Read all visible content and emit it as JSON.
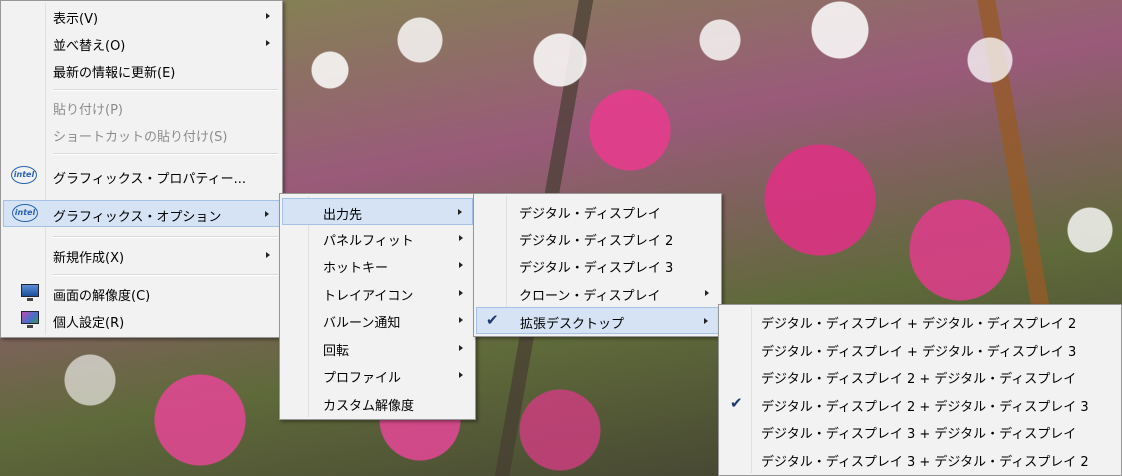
{
  "desktop_menu": {
    "items": [
      {
        "label": "表示(V)",
        "submenu": true
      },
      {
        "label": "並べ替え(O)",
        "submenu": true
      },
      {
        "label": "最新の情報に更新(E)"
      },
      {
        "label": "貼り付け(P)",
        "disabled": true
      },
      {
        "label": "ショートカットの貼り付け(S)",
        "disabled": true
      },
      {
        "label": "グラフィックス・プロパティー...",
        "icon": "intel-logo-icon"
      },
      {
        "label": "グラフィックス・オプション",
        "icon": "intel-logo-icon",
        "submenu": true,
        "highlighted": true
      },
      {
        "label": "新規作成(X)",
        "submenu": true
      },
      {
        "label": "画面の解像度(C)",
        "icon": "display-monitor-icon"
      },
      {
        "label": "個人設定(R)",
        "icon": "personalize-monitor-icon"
      }
    ]
  },
  "graphics_options_menu": {
    "items": [
      {
        "label": "出力先",
        "submenu": true,
        "highlighted": true
      },
      {
        "label": "パネルフィット",
        "submenu": true
      },
      {
        "label": "ホットキー",
        "submenu": true
      },
      {
        "label": "トレイアイコン",
        "submenu": true
      },
      {
        "label": "バルーン通知",
        "submenu": true
      },
      {
        "label": "回転",
        "submenu": true
      },
      {
        "label": "プロファイル",
        "submenu": true
      },
      {
        "label": "カスタム解像度"
      }
    ]
  },
  "output_menu": {
    "items": [
      {
        "label": "デジタル・ディスプレイ"
      },
      {
        "label": "デジタル・ディスプレイ 2"
      },
      {
        "label": "デジタル・ディスプレイ 3"
      },
      {
        "label": "クローン・ディスプレイ",
        "submenu": true
      },
      {
        "label": "拡張デスクトップ",
        "submenu": true,
        "highlighted": true,
        "checked": true
      }
    ]
  },
  "extended_menu": {
    "items": [
      {
        "label": "デジタル・ディスプレイ + デジタル・ディスプレイ 2"
      },
      {
        "label": "デジタル・ディスプレイ + デジタル・ディスプレイ 3"
      },
      {
        "label": "デジタル・ディスプレイ 2 + デジタル・ディスプレイ"
      },
      {
        "label": "デジタル・ディスプレイ 2 + デジタル・ディスプレイ 3",
        "checked": true
      },
      {
        "label": "デジタル・ディスプレイ 3 + デジタル・ディスプレイ"
      },
      {
        "label": "デジタル・ディスプレイ 3 + デジタル・ディスプレイ 2"
      }
    ]
  },
  "glyphs": {
    "check": "✔"
  },
  "colors": {
    "menu_bg": "#f2f2f2",
    "highlight": "#d5e3f5",
    "highlight_border": "#a6c1e6",
    "disabled_text": "#8c8c8c"
  }
}
